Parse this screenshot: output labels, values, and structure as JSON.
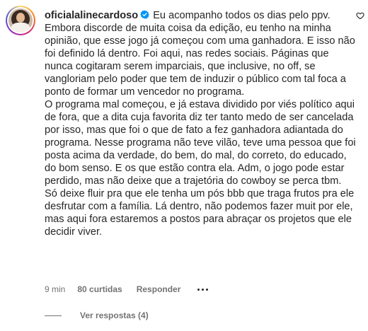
{
  "comment": {
    "username": "oficialalinecardoso",
    "verified": true,
    "paragraph1": "Eu acompanho todos os dias pelo ppv. Embora discorde de muita coisa da edição, eu tenho na minha opinião, que esse jogo já começou com uma ganhadora. E isso não foi definido lá dentro. Foi aqui, nas redes sociais. Páginas que nunca cogitaram serem imparciais, que inclusive, no off, se vangloriam pelo poder que tem de induzir o público com tal foca a ponto de formar um vencedor no programa.",
    "paragraph2": "O programa mal começou, e já estava dividido por viés político aqui de fora, que a dita cuja favorita diz ter tanto medo de ser cancelada por isso, mas que foi o que de fato a fez ganhadora adiantada do programa. Nesse programa não teve vilão, teve uma pessoa que foi posta acima da verdade, do bem, do mal, do correto, do educado, do bom senso. E os que estão contra ela. Adm, o jogo pode estar perdido, mas não deixe que a trajetória do cowboy se perca tbm. Só deixe fluir pra que ele tenha um pós bbb que traga frutos pra ele desfrutar com a família. Lá dentro, não podemos fazer muit por ele, mas aqui fora estaremos a postos para abraçar os projetos que ele decidir viver.",
    "time": "9 min",
    "likes": "80 curtidas",
    "reply_label": "Responder",
    "more_icon": "more-horizontal-icon",
    "like_icon": "heart-outline-icon",
    "verified_icon": "verified-badge-icon"
  },
  "replies": {
    "label": "Ver respostas (4)"
  },
  "colors": {
    "text": "#262626",
    "secondary": "#737373",
    "verified": "#0095f6",
    "background": "#ffffff"
  }
}
